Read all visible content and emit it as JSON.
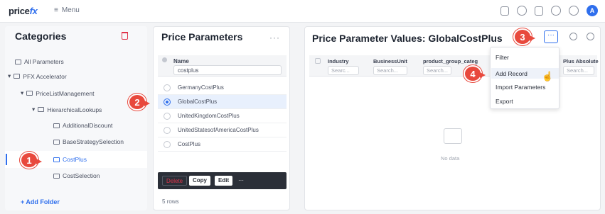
{
  "app": {
    "logo_text": "price",
    "logo_fx": "fx",
    "menu_label": "Menu"
  },
  "colors": {
    "accent": "#2f6fed",
    "danger": "#e0344b",
    "badge": "#e8493d"
  },
  "categories": {
    "title": "Categories",
    "items": [
      {
        "label": "All Parameters"
      },
      {
        "label": "PFX Accelerator"
      },
      {
        "label": "PriceListManagement"
      },
      {
        "label": "HierarchicalLookups"
      },
      {
        "label": "AdditionalDiscount"
      },
      {
        "label": "BaseStrategySelection"
      },
      {
        "label": "CostPlus",
        "selected": true
      },
      {
        "label": "CostSelection"
      }
    ],
    "add_folder": "+ Add Folder"
  },
  "price_parameters": {
    "title": "Price Parameters",
    "more": "···",
    "name_col": "Name",
    "search_value": "costplus",
    "rows": [
      {
        "name": "GermanyCostPlus"
      },
      {
        "name": "GlobalCostPlus",
        "selected": true
      },
      {
        "name": "UnitedKingdomCostPlus"
      },
      {
        "name": "UnitedStatesofAmericaCostPlus"
      },
      {
        "name": "CostPlus"
      }
    ],
    "actions": {
      "delete": "Delete",
      "copy": "Copy",
      "edit": "Edit",
      "more": "···"
    },
    "rows_count": "5 rows"
  },
  "values": {
    "title": "Price Parameter Values: GlobalCostPlus",
    "more": "···",
    "columns": [
      "Industry",
      "BusinessUnit",
      "product_group_categ",
      "Plus Absolute"
    ],
    "search_placeholder": "Searc...",
    "search_placeholder_long": "Search...",
    "no_data": "No data",
    "menu": [
      "Filter",
      "Add Record",
      "Import Parameters",
      "Export"
    ]
  },
  "badges": [
    "1",
    "2",
    "3",
    "4"
  ]
}
